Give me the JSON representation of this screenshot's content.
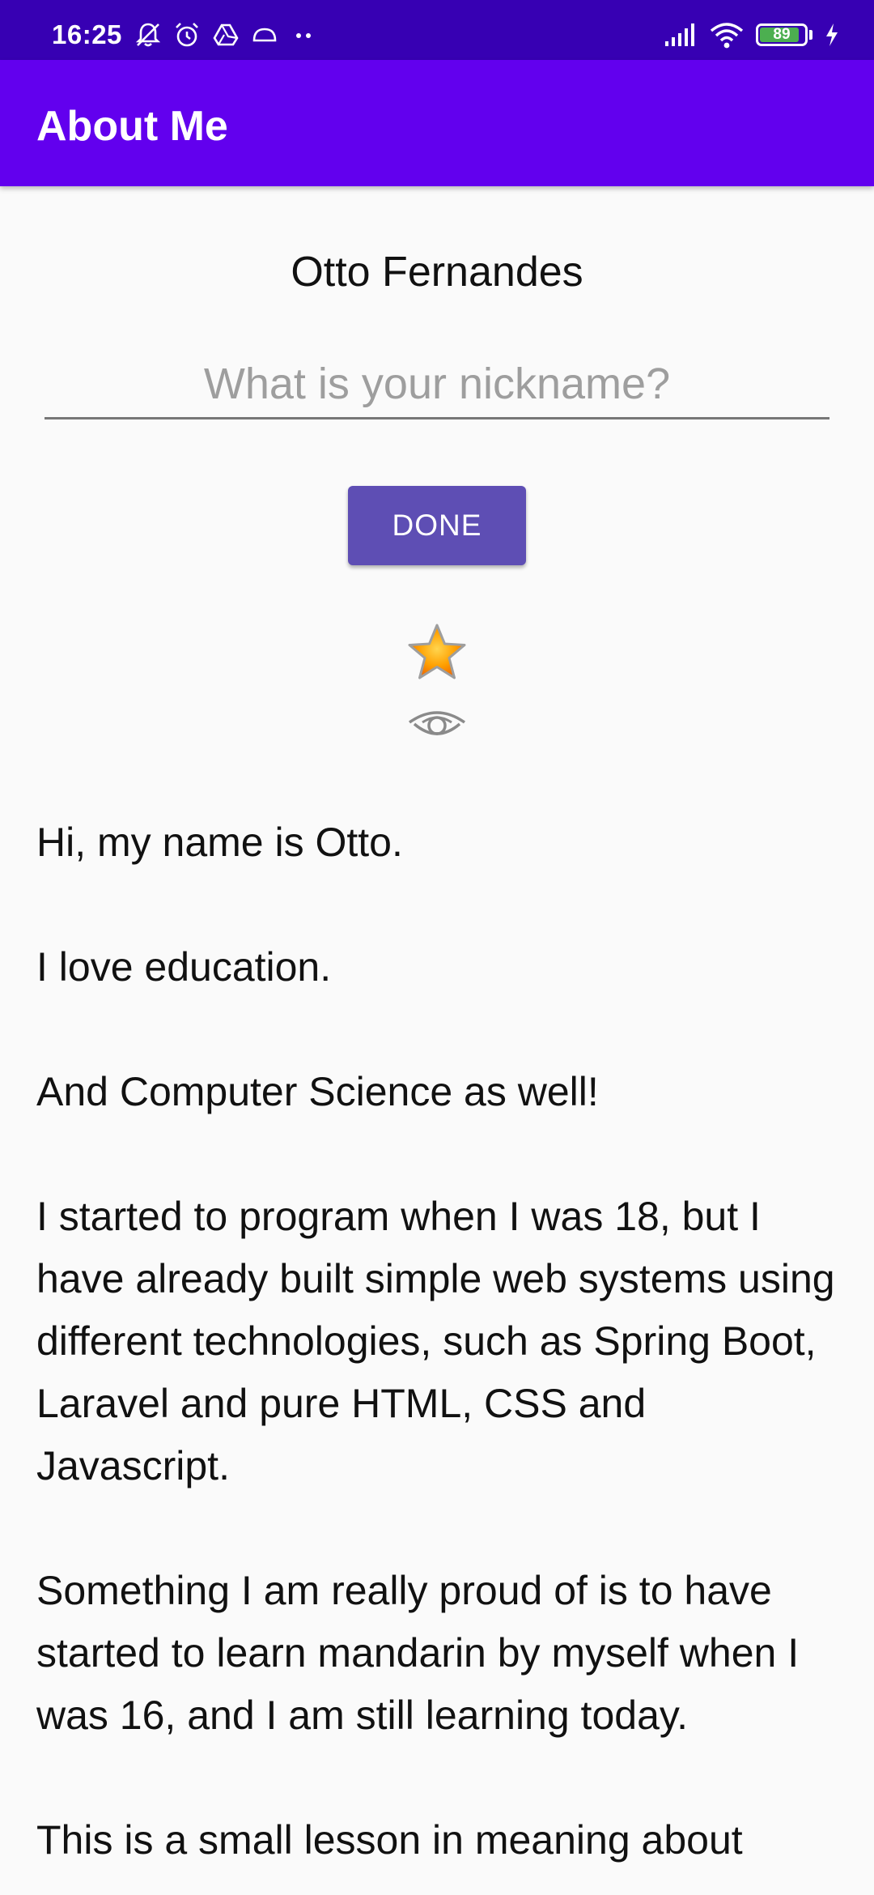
{
  "status_bar": {
    "time": "16:25",
    "battery_level": "89",
    "left_icons": [
      "notifications-muted-icon",
      "alarm-icon",
      "drive-icon",
      "cloud-icon",
      "more-notifications-icon"
    ],
    "right_icons": [
      "signal-icon",
      "wifi-icon",
      "battery-icon",
      "charging-icon"
    ]
  },
  "app_bar": {
    "title": "About Me"
  },
  "profile": {
    "name": "Otto Fernandes"
  },
  "nickname": {
    "placeholder": "What is your nickname?",
    "value": ""
  },
  "done_button": {
    "label": "DONE"
  },
  "icons": {
    "star": "star-icon",
    "eye": "eye-icon"
  },
  "bio": {
    "text": "Hi, my name is Otto.\n\nI love education.\n\nAnd Computer Science as well!\n\nI started to program when I was 18, but I have already built simple web systems using different technologies, such as Spring Boot, Laravel and pure HTML, CSS and Javascript.\n\nSomething I am really proud of is to have started to learn mandarin by myself when I was 16, and I am still learning today.\n\nThis is a small lesson in meaning about"
  },
  "colors": {
    "status_bar": "#3700b3",
    "app_bar": "#6200ee",
    "button": "#5e4eb4",
    "background": "#fafafa"
  }
}
